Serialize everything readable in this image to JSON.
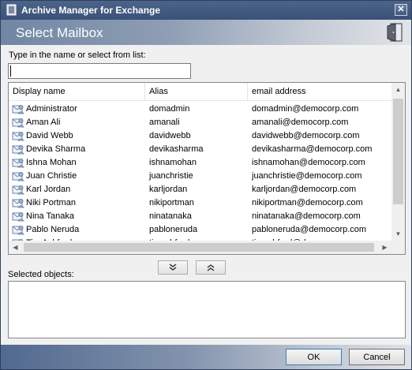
{
  "window": {
    "title": "Archive Manager for Exchange",
    "close_glyph": "✕"
  },
  "banner": {
    "title": "Select Mailbox",
    "icon": "door-exit-icon"
  },
  "search": {
    "label": "Type in the name or select from list:",
    "value": "",
    "placeholder": ""
  },
  "list": {
    "columns": [
      "Display name",
      "Alias",
      "email address"
    ],
    "rows": [
      {
        "name": "Administrator",
        "alias": "domadmin",
        "email": "domadmin@democorp.com"
      },
      {
        "name": "Aman Ali",
        "alias": "amanali",
        "email": "amanali@democorp.com"
      },
      {
        "name": "David Webb",
        "alias": "davidwebb",
        "email": "davidwebb@democorp.com"
      },
      {
        "name": "Devika Sharma",
        "alias": "devikasharma",
        "email": "devikasharma@democorp.com"
      },
      {
        "name": "Ishna Mohan",
        "alias": "ishnamohan",
        "email": "ishnamohan@democorp.com"
      },
      {
        "name": "Juan Christie",
        "alias": "juanchristie",
        "email": "juanchristie@democorp.com"
      },
      {
        "name": "Karl Jordan",
        "alias": "karljordan",
        "email": "karljordan@democorp.com"
      },
      {
        "name": "Niki Portman",
        "alias": "nikiportman",
        "email": "nikiportman@democorp.com"
      },
      {
        "name": "Nina Tanaka",
        "alias": "ninatanaka",
        "email": "ninatanaka@democorp.com"
      },
      {
        "name": "Pablo Neruda",
        "alias": "pabloneruda",
        "email": "pabloneruda@democorp.com"
      },
      {
        "name": "Tim Ashford",
        "alias": "timashford",
        "email": "timashford@democorp.com"
      }
    ]
  },
  "move_buttons": {
    "down_icon": "double-chevron-down-icon",
    "up_icon": "double-chevron-up-icon"
  },
  "selected": {
    "label": "Selected objects:"
  },
  "buttons": {
    "ok": "OK",
    "cancel": "Cancel"
  },
  "colors": {
    "titlebar": "#3a5178",
    "banner_start": "#7186a4",
    "footer_start": "#51698f"
  }
}
